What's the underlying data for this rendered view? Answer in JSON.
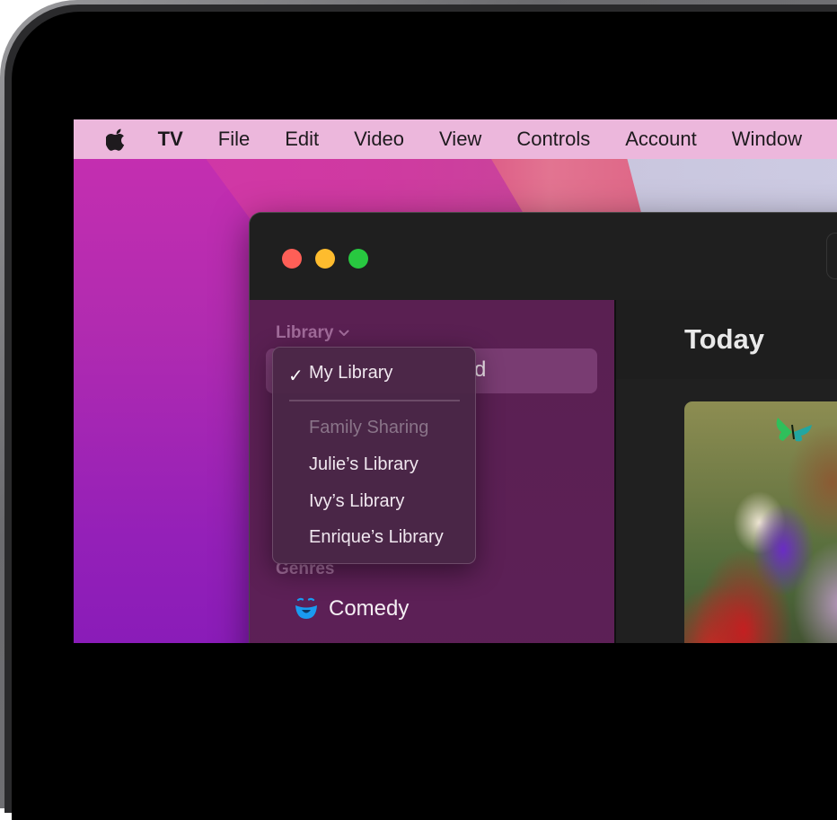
{
  "menubar": {
    "apple_icon": "apple-logo-icon",
    "items": [
      "TV",
      "File",
      "Edit",
      "Video",
      "View",
      "Controls",
      "Account",
      "Window"
    ]
  },
  "window": {
    "traffic_lights": {
      "close_color": "#fe5f57",
      "minimize_color": "#febc2e",
      "zoom_color": "#28c840"
    }
  },
  "sidebar": {
    "library_heading": "Library",
    "library_chevron_icon": "chevron-down-icon",
    "selected_item_partial": "d",
    "genres_heading": "Genres",
    "genres": [
      {
        "label": "Comedy",
        "icon": "comedy-mask-icon",
        "icon_color": "#1a9bf0"
      }
    ]
  },
  "library_menu": {
    "items": [
      {
        "label": "My Library",
        "checked": true
      },
      {
        "label": "Family Sharing",
        "header": true
      },
      {
        "label": "Julie’s Library"
      },
      {
        "label": "Ivy’s Library"
      },
      {
        "label": "Enrique’s Library"
      }
    ],
    "check_glyph": "✓"
  },
  "main": {
    "title": "Today"
  },
  "colors": {
    "menubar_bg": "#ecb7dc",
    "sidebar_bg": "#5b2054",
    "selected_row_bg": "#793c72",
    "window_bg": "#1e1e1e"
  }
}
